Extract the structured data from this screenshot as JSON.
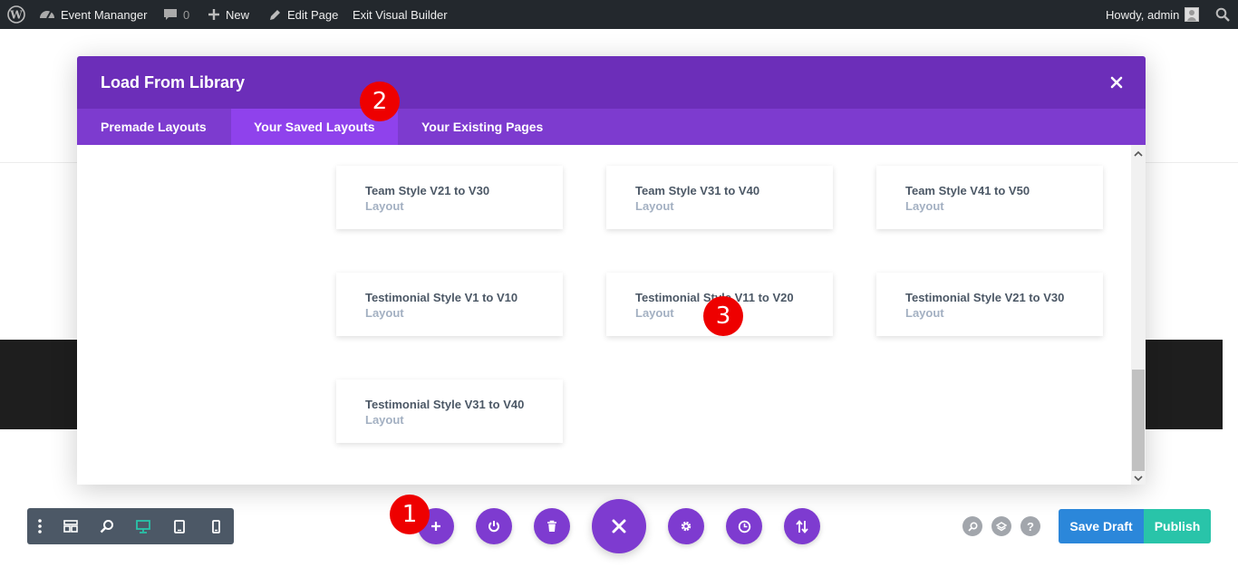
{
  "adminbar": {
    "site_name": "Event Mananger",
    "comments_count": "0",
    "new_label": "New",
    "edit_page_label": "Edit Page",
    "exit_builder_label": "Exit Visual Builder",
    "howdy": "Howdy, admin"
  },
  "modal": {
    "title": "Load From Library",
    "tabs": [
      {
        "label": "Premade Layouts"
      },
      {
        "label": "Your Saved Layouts",
        "active": true
      },
      {
        "label": "Your Existing Pages"
      }
    ],
    "layouts": [
      {
        "title": "Team Style V21 to V30",
        "type": "Layout"
      },
      {
        "title": "Team Style V31 to V40",
        "type": "Layout"
      },
      {
        "title": "Team Style V41 to V50",
        "type": "Layout"
      },
      {
        "title": "Testimonial Style V1 to V10",
        "type": "Layout"
      },
      {
        "title": "Testimonial Style V11 to V20",
        "type": "Layout"
      },
      {
        "title": "Testimonial Style V21 to V30",
        "type": "Layout"
      },
      {
        "title": "Testimonial Style V31 to V40",
        "type": "Layout"
      }
    ]
  },
  "markers": [
    "1",
    "2",
    "3"
  ],
  "bottom_bar": {
    "left_toolbar_icons": [
      "more-vertical-icon",
      "wireframe-icon",
      "zoom-icon",
      "desktop-icon",
      "tablet-icon",
      "phone-icon"
    ],
    "center_icons": [
      "plus-icon",
      "power-icon",
      "trash-icon",
      "close-icon",
      "gear-icon",
      "history-icon",
      "sort-icon"
    ],
    "right_icons": [
      "search-icon",
      "layers-icon",
      "help-icon"
    ],
    "help_glyph": "?",
    "save_draft_label": "Save Draft",
    "publish_label": "Publish"
  },
  "colors": {
    "modal_header": "#6c2eb9",
    "tab_bar": "#7d3bcf",
    "active_tab": "#8f42ec",
    "builder_purple": "#7e3bd0",
    "save_draft": "#2b87da",
    "publish": "#29c4a9",
    "marker": "#ee0000",
    "admin_bar": "#23282d"
  }
}
